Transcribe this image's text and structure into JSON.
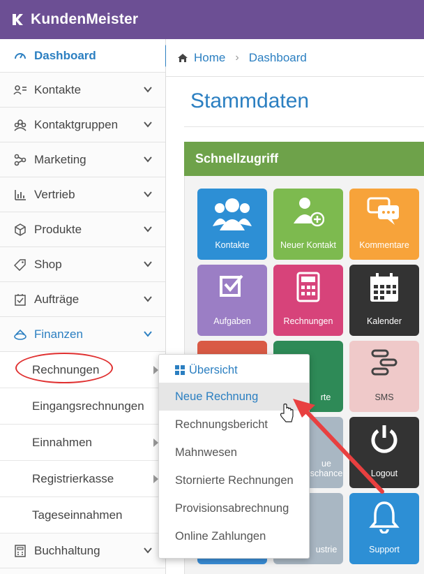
{
  "brand": {
    "name": "KundenMeister",
    "logo_icon": "k-logo-icon"
  },
  "sidebar": {
    "items": [
      {
        "label": "Dashboard",
        "icon": "gauge-icon"
      },
      {
        "label": "Kontakte",
        "icon": "contacts-icon"
      },
      {
        "label": "Kontaktgruppen",
        "icon": "group-icon"
      },
      {
        "label": "Marketing",
        "icon": "marketing-icon"
      },
      {
        "label": "Vertrieb",
        "icon": "bar-chart-icon"
      },
      {
        "label": "Produkte",
        "icon": "box-icon"
      },
      {
        "label": "Shop",
        "icon": "tag-icon"
      },
      {
        "label": "Aufträge",
        "icon": "clipboard-icon"
      },
      {
        "label": "Finanzen",
        "icon": "coins-icon"
      },
      {
        "label": "Buchhaltung",
        "icon": "calculator-icon"
      }
    ],
    "finanzen_sub": [
      {
        "label": "Rechnungen"
      },
      {
        "label": "Eingangsrechnungen"
      },
      {
        "label": "Einnahmen"
      },
      {
        "label": "Registrierkasse"
      },
      {
        "label": "Tageseinnahmen"
      }
    ]
  },
  "breadcrumb": {
    "home": "Home",
    "current": "Dashboard"
  },
  "page": {
    "title": "Stammdaten"
  },
  "panel": {
    "title": "Schnellzugriff",
    "tiles": [
      {
        "label": "Kontakte",
        "color": "#2d8fd5"
      },
      {
        "label": "Neuer Kontakt",
        "color": "#7dba4f"
      },
      {
        "label": "Kommentare",
        "color": "#f7a33a"
      },
      {
        "label": "Aufgaben",
        "color": "#9b7ec5"
      },
      {
        "label": "Rechnungen",
        "color": "#d7437a"
      },
      {
        "label": "Kalender",
        "color": "#333333"
      },
      {
        "label": "",
        "color": "#d95a45"
      },
      {
        "label": "rte",
        "color": "#2e8a57"
      },
      {
        "label": "SMS",
        "color": "#efc9c9"
      },
      {
        "label": "",
        "color": "#8f9aa5"
      },
      {
        "label": "ue schance",
        "color": "#a9b7c3"
      },
      {
        "label": "Logout",
        "color": "#333333"
      },
      {
        "label": "",
        "color": "#3a8fd9"
      },
      {
        "label": "ustrie",
        "color": "#a9b7c3"
      },
      {
        "label": "Support",
        "color": "#2d8fd5"
      }
    ]
  },
  "dropdown": {
    "items": [
      {
        "label": "Übersicht"
      },
      {
        "label": "Neue Rechnung"
      },
      {
        "label": "Rechnungsbericht"
      },
      {
        "label": "Mahnwesen"
      },
      {
        "label": "Stornierte Rechnungen"
      },
      {
        "label": "Provisionsabrechnung"
      },
      {
        "label": "Online Zahlungen"
      }
    ]
  },
  "colors": {
    "accent": "#2b7fc1",
    "topbar": "#6c4f94",
    "panel_head": "#6ea24a",
    "annotation": "#e03030"
  }
}
